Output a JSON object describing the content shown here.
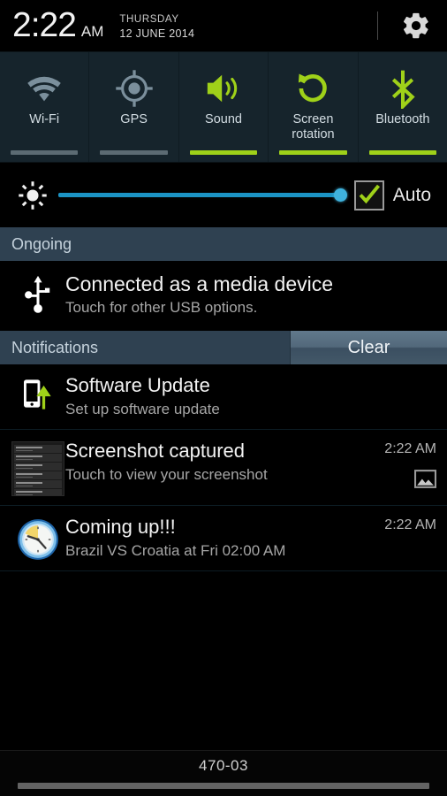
{
  "status": {
    "time": "2:22",
    "ampm": "AM",
    "day": "THURSDAY",
    "date": "12 JUNE 2014",
    "settings_icon": "gear-icon"
  },
  "quick_settings": {
    "tiles": [
      {
        "label": "Wi-Fi",
        "icon": "wifi-icon",
        "state": "off"
      },
      {
        "label": "GPS",
        "icon": "gps-icon",
        "state": "off"
      },
      {
        "label": "Sound",
        "icon": "volume-icon",
        "state": "on"
      },
      {
        "label": "Screen\nrotation",
        "icon": "screen-rotation-icon",
        "state": "on"
      },
      {
        "label": "Bluetooth",
        "icon": "bluetooth-icon",
        "state": "on"
      }
    ],
    "label_screen_rotation_l1": "Screen",
    "label_screen_rotation_l2": "rotation",
    "on_color": "#9fd119",
    "off_color": "#5c6b73"
  },
  "brightness": {
    "icon": "brightness-icon",
    "value_percent": 100,
    "track_color": "#1b93c4",
    "auto_label": "Auto",
    "auto_checked": true,
    "check_color": "#9fd119"
  },
  "sections": {
    "ongoing_title": "Ongoing",
    "notifications_title": "Notifications",
    "clear_label": "Clear"
  },
  "ongoing": [
    {
      "icon": "usb-icon",
      "title": "Connected as a media device",
      "subtitle": "Touch for other USB options."
    }
  ],
  "notifications": [
    {
      "icon": "software-update-icon",
      "title": "Software Update",
      "subtitle": "Set up software update",
      "time": "",
      "badge_icon": ""
    },
    {
      "icon": "screenshot-thumbnail",
      "title": "Screenshot captured",
      "subtitle": "Touch to view your screenshot",
      "time": "2:22 AM",
      "badge_icon": "gallery-image-icon"
    },
    {
      "icon": "alarm-clock-icon",
      "title": "Coming up!!!",
      "subtitle": "Brazil VS Croatia at Fri 02:00 AM",
      "time": "2:22 AM",
      "badge_icon": ""
    }
  ],
  "bottom": {
    "carrier": "470-03",
    "handle": "drag-handle"
  }
}
